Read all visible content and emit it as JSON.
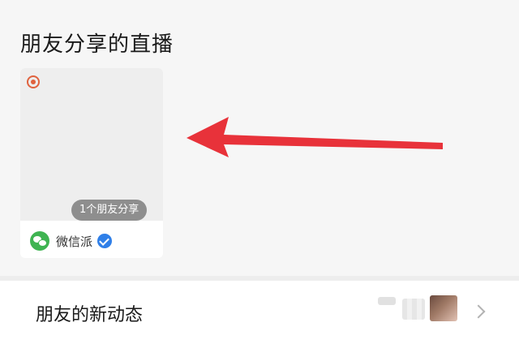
{
  "section": {
    "title": "朋友分享的直播"
  },
  "live_card": {
    "share_badge": "1个朋友分享",
    "author_name": "微信派",
    "live_indicator_icon": "live-record-icon",
    "author_logo_icon": "wechat-logo-icon",
    "verified_icon": "verified-badge-icon"
  },
  "friends_moments": {
    "label": "朋友的新动态",
    "chevron_icon": "chevron-right-icon"
  },
  "colors": {
    "arrow": "#e8323a",
    "live_dot": "#e0623e",
    "wechat_green": "#3fb452",
    "verified_blue": "#2f7fe8"
  }
}
